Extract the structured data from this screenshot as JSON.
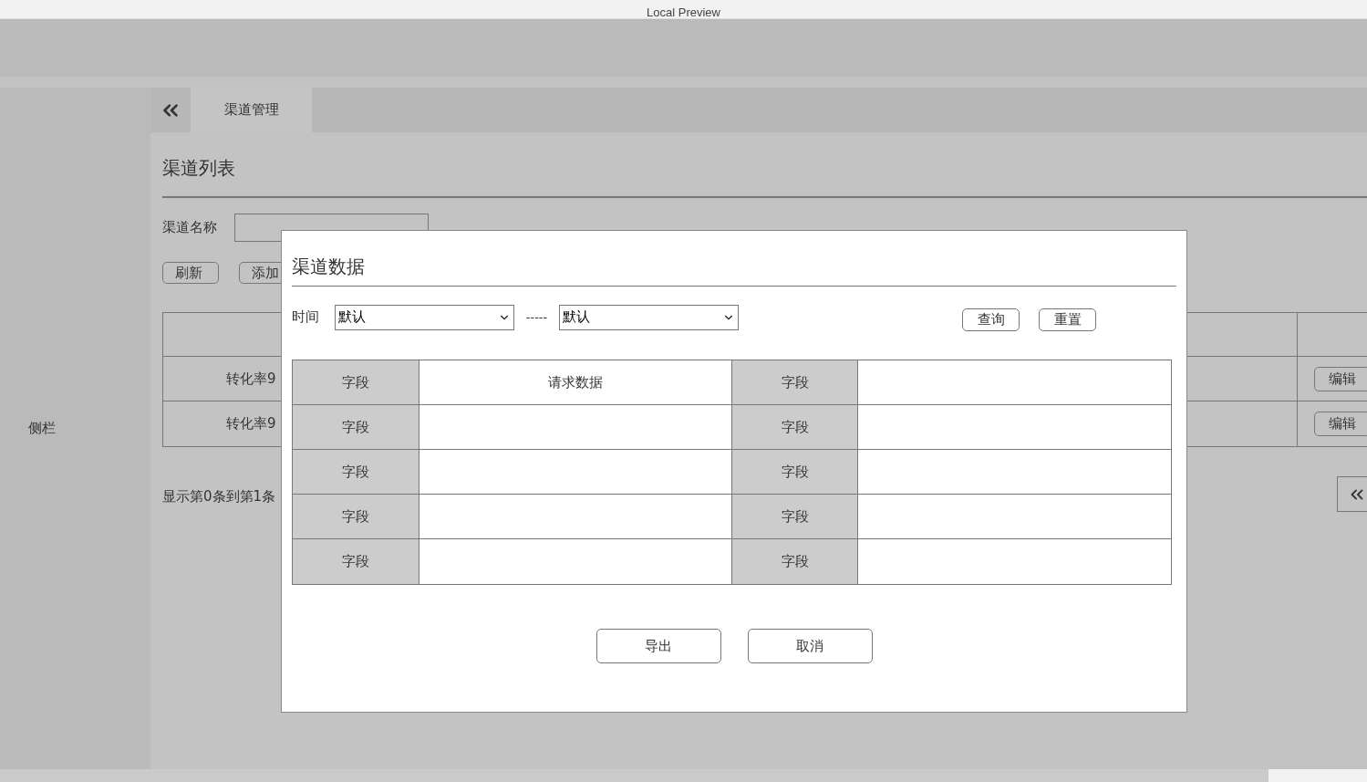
{
  "browser": {
    "title": "Local Preview"
  },
  "sidebar": {
    "label": "侧栏"
  },
  "tabs": [
    {
      "label": "渠道管理",
      "selected": true
    }
  ],
  "page": {
    "title": "渠道列表",
    "filter_label": "渠道名称",
    "buttons": [
      "刷新",
      "添加"
    ],
    "table_rows": [
      {
        "cell_1": "转化率9",
        "action": "编辑"
      },
      {
        "cell_1": "转化率9",
        "action": "编辑"
      }
    ],
    "footer": "显示第0条到第1条"
  },
  "dialog": {
    "title": "渠道数据",
    "time_label": "时间",
    "start_select": "默认",
    "separator": "-----",
    "end_select": "默认",
    "buttons": [
      "查询",
      "重置"
    ],
    "rows": [
      {
        "label_1": "字段",
        "value_1": "请求数据",
        "label_2": "字段"
      },
      {
        "label_1": "字段",
        "label_2": "字段"
      },
      {
        "label_1": "字段",
        "label_2": "字段"
      },
      {
        "label_1": "字段",
        "label_2": "字段"
      },
      {
        "label_1": "字段",
        "label_2": "字段"
      }
    ],
    "footer_buttons": [
      "导出",
      "取消"
    ]
  }
}
